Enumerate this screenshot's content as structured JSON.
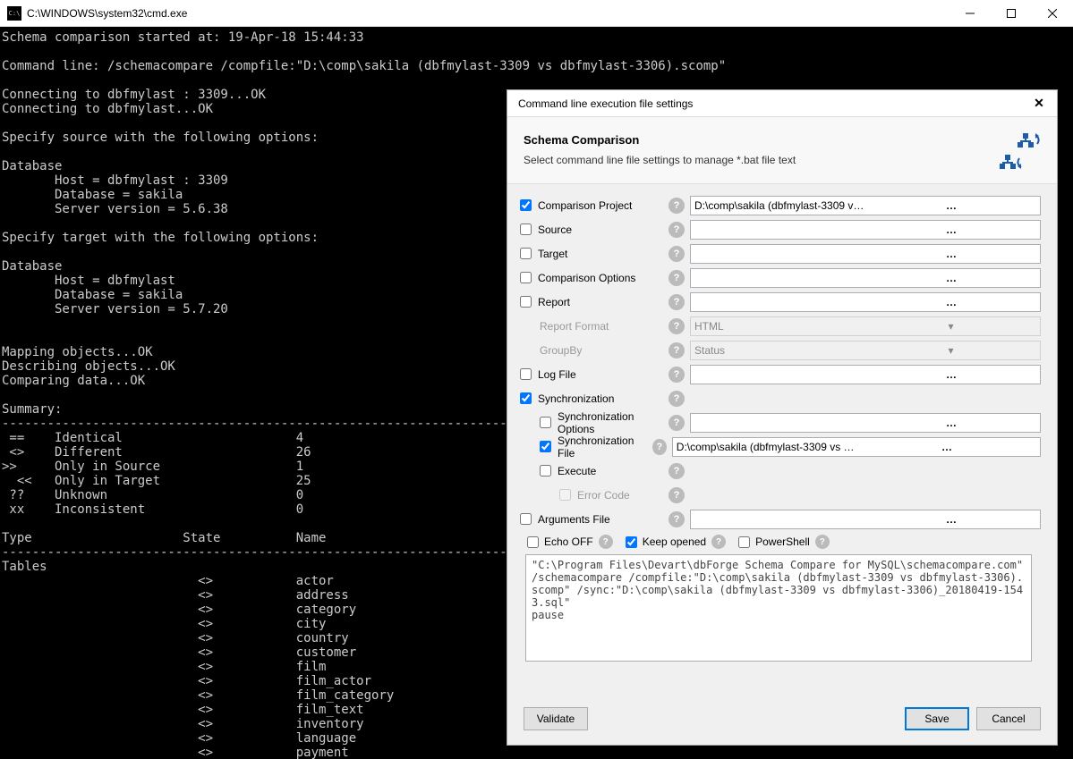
{
  "window": {
    "title": "C:\\WINDOWS\\system32\\cmd.exe",
    "icon_label": "cmd-icon",
    "min": "–",
    "max": "☐",
    "close": "✕"
  },
  "console_text": "Schema comparison started at: 19-Apr-18 15:44:33\n\nCommand line: /schemacompare /compfile:\"D:\\comp\\sakila (dbfmylast-3309 vs dbfmylast-3306).scomp\"\n\nConnecting to dbfmylast : 3309...OK\nConnecting to dbfmylast...OK\n\nSpecify source with the following options:\n\nDatabase\n       Host = dbfmylast : 3309\n       Database = sakila\n       Server version = 5.6.38\n\nSpecify target with the following options:\n\nDatabase\n       Host = dbfmylast\n       Database = sakila\n       Server version = 5.7.20\n\n\nMapping objects...OK\nDescribing objects...OK\nComparing data...OK\n\nSummary:\n----------------------------------------------------------------------------\n ==    Identical                       4\n <>    Different                       26\n>>     Only in Source                  1\n  <<   Only in Target                  25\n ??    Unknown                         0\n xx    Inconsistent                    0\n\nType                    State          Name\n----------------------------------------------------------------------------\nTables\n                          <>           actor\n                          <>           address\n                          <>           category\n                          <>           city\n                          <>           country\n                          <>           customer\n                          <>           film\n                          <>           film_actor\n                          <>           film_category\n                          <>           film_text\n                          <>           inventory\n                          <>           language\n                          <>           payment",
  "dialog": {
    "title": "Command line execution file settings",
    "close": "✕",
    "header_title": "Schema Comparison",
    "header_sub": "Select command line file settings to manage *.bat file text",
    "rows": {
      "comparison_project": {
        "label": "Comparison Project",
        "checked": true,
        "value": "D:\\comp\\sakila (dbfmylast-3309 vs dbfmylast-3306).scomp"
      },
      "source": {
        "label": "Source",
        "checked": false,
        "value": ""
      },
      "target": {
        "label": "Target",
        "checked": false,
        "value": ""
      },
      "comparison_options": {
        "label": "Comparison Options",
        "checked": false,
        "value": ""
      },
      "report": {
        "label": "Report",
        "checked": false,
        "value": ""
      },
      "report_format": {
        "label": "Report Format",
        "value": "HTML"
      },
      "group_by": {
        "label": "GroupBy",
        "value": "Status"
      },
      "log_file": {
        "label": "Log File",
        "checked": false,
        "value": ""
      },
      "synchronization": {
        "label": "Synchronization",
        "checked": true
      },
      "sync_options": {
        "label": "Synchronization Options",
        "checked": false,
        "value": ""
      },
      "sync_file": {
        "label": "Synchronization File",
        "checked": true,
        "value": "D:\\comp\\sakila (dbfmylast-3309 vs dbfmylast-3306)_20180419-1543.sql"
      },
      "execute": {
        "label": "Execute",
        "checked": false
      },
      "error_code": {
        "label": "Error Code",
        "value": ""
      },
      "arguments_file": {
        "label": "Arguments File",
        "checked": false,
        "value": ""
      }
    },
    "options": {
      "echo_off": {
        "label": "Echo OFF",
        "checked": false
      },
      "keep_opened": {
        "label": "Keep opened",
        "checked": true
      },
      "powershell": {
        "label": "PowerShell",
        "checked": false
      }
    },
    "preview": "\"C:\\Program Files\\Devart\\dbForge Schema Compare for MySQL\\schemacompare.com\" /schemacompare /compfile:\"D:\\comp\\sakila (dbfmylast-3309 vs dbfmylast-3306).scomp\" /sync:\"D:\\comp\\sakila (dbfmylast-3309 vs dbfmylast-3306)_20180419-1543.sql\"\npause",
    "buttons": {
      "validate": "Validate",
      "save": "Save",
      "cancel": "Cancel"
    }
  }
}
